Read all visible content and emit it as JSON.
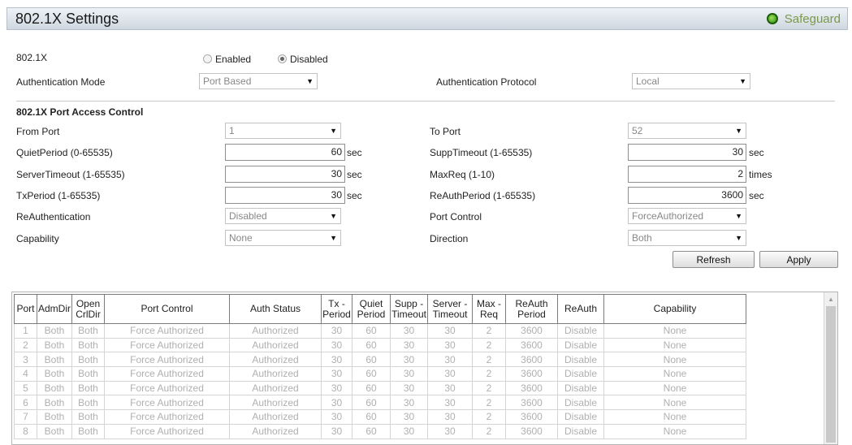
{
  "header": {
    "title": "802.1X Settings",
    "safeguard": "Safeguard"
  },
  "global": {
    "dot1x_label": "802.1X",
    "enabled_label": "Enabled",
    "disabled_label": "Disabled",
    "selected": "Disabled",
    "auth_mode_label": "Authentication Mode",
    "auth_mode_value": "Port Based",
    "auth_protocol_label": "Authentication Protocol",
    "auth_protocol_value": "Local"
  },
  "port_access": {
    "section_title": "802.1X Port Access Control",
    "from_port_label": "From Port",
    "from_port_value": "1",
    "to_port_label": "To Port",
    "to_port_value": "52",
    "quiet_label": "QuietPeriod (0-65535)",
    "quiet_value": "60",
    "supp_label": "SuppTimeout (1-65535)",
    "supp_value": "30",
    "server_label": "ServerTimeout (1-65535)",
    "server_value": "30",
    "maxreq_label": "MaxReq (1-10)",
    "maxreq_value": "2",
    "tx_label": "TxPeriod (1-65535)",
    "tx_value": "30",
    "reauthperiod_label": "ReAuthPeriod (1-65535)",
    "reauthperiod_value": "3600",
    "reauth_label": "ReAuthentication",
    "reauth_value": "Disabled",
    "portcontrol_label": "Port Control",
    "portcontrol_value": "ForceAuthorized",
    "capability_label": "Capability",
    "capability_value": "None",
    "direction_label": "Direction",
    "direction_value": "Both",
    "unit_sec": "sec",
    "unit_times": "times"
  },
  "buttons": {
    "refresh": "Refresh",
    "apply": "Apply"
  },
  "table": {
    "headers": [
      [
        "Port"
      ],
      [
        "AdmDir"
      ],
      [
        "Open",
        "CrlDir"
      ],
      [
        "Port Control"
      ],
      [
        "Auth Status"
      ],
      [
        "Tx -",
        "Period"
      ],
      [
        "Quiet",
        "Period"
      ],
      [
        "Supp -",
        "Timeout"
      ],
      [
        "Server -",
        "Timeout"
      ],
      [
        "Max -",
        "Req"
      ],
      [
        "ReAuth",
        "Period"
      ],
      [
        "ReAuth"
      ],
      [
        "Capability"
      ]
    ],
    "rows": [
      [
        "1",
        "Both",
        "Both",
        "Force Authorized",
        "Authorized",
        "30",
        "60",
        "30",
        "30",
        "2",
        "3600",
        "Disable",
        "None"
      ],
      [
        "2",
        "Both",
        "Both",
        "Force Authorized",
        "Authorized",
        "30",
        "60",
        "30",
        "30",
        "2",
        "3600",
        "Disable",
        "None"
      ],
      [
        "3",
        "Both",
        "Both",
        "Force Authorized",
        "Authorized",
        "30",
        "60",
        "30",
        "30",
        "2",
        "3600",
        "Disable",
        "None"
      ],
      [
        "4",
        "Both",
        "Both",
        "Force Authorized",
        "Authorized",
        "30",
        "60",
        "30",
        "30",
        "2",
        "3600",
        "Disable",
        "None"
      ],
      [
        "5",
        "Both",
        "Both",
        "Force Authorized",
        "Authorized",
        "30",
        "60",
        "30",
        "30",
        "2",
        "3600",
        "Disable",
        "None"
      ],
      [
        "6",
        "Both",
        "Both",
        "Force Authorized",
        "Authorized",
        "30",
        "60",
        "30",
        "30",
        "2",
        "3600",
        "Disable",
        "None"
      ],
      [
        "7",
        "Both",
        "Both",
        "Force Authorized",
        "Authorized",
        "30",
        "60",
        "30",
        "30",
        "2",
        "3600",
        "Disable",
        "None"
      ],
      [
        "8",
        "Both",
        "Both",
        "Force Authorized",
        "Authorized",
        "30",
        "60",
        "30",
        "30",
        "2",
        "3600",
        "Disable",
        "None"
      ]
    ]
  }
}
